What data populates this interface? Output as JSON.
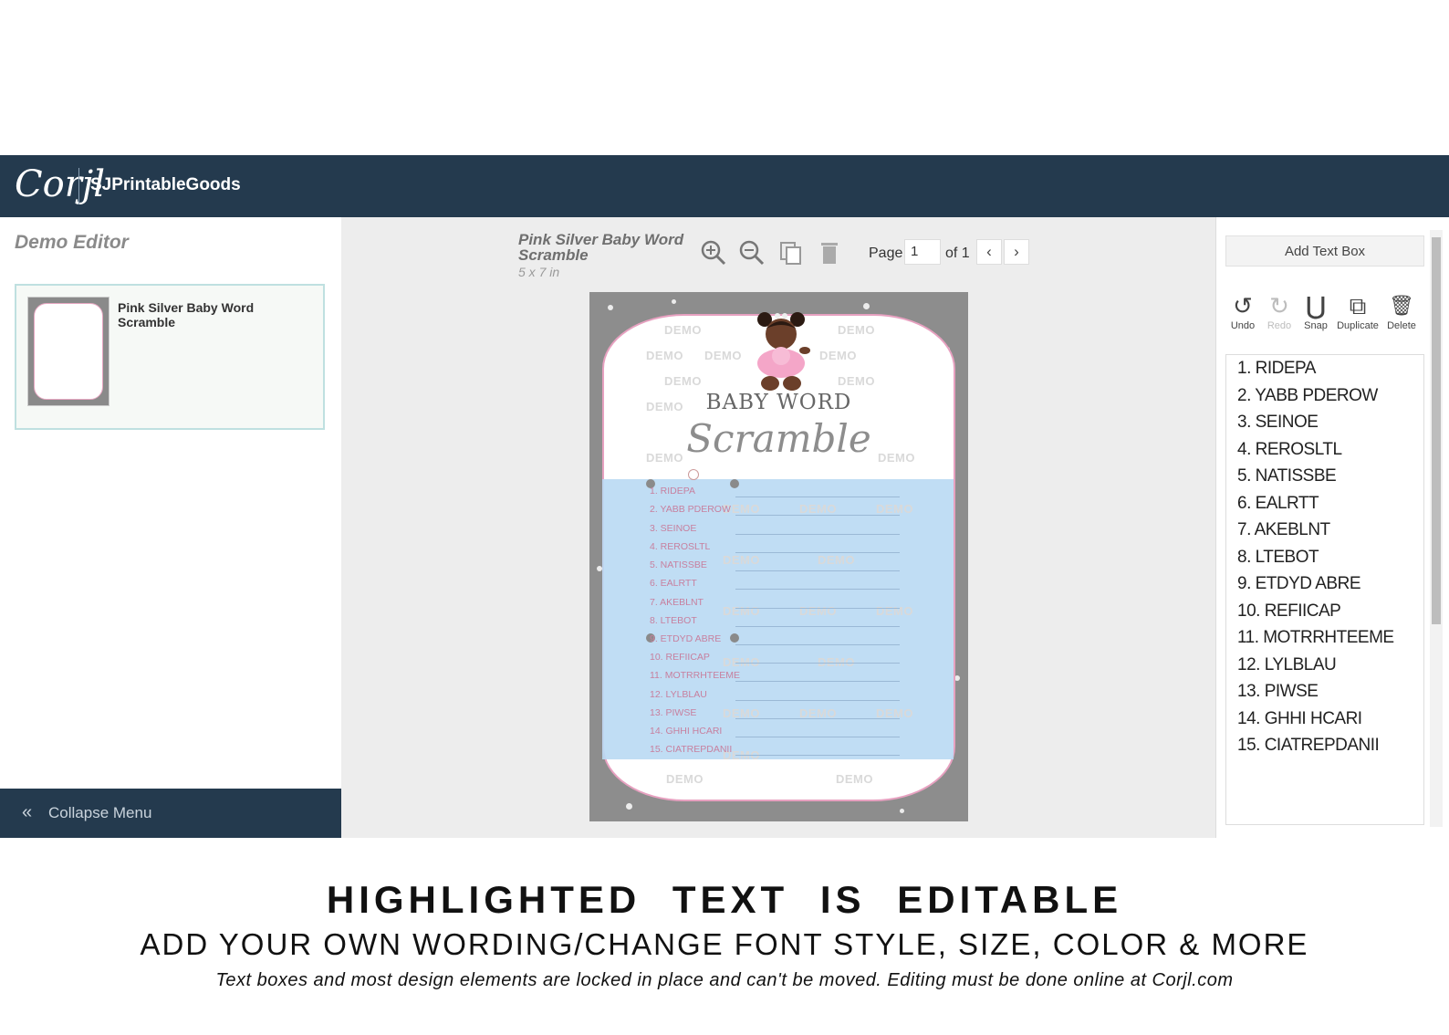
{
  "header": {
    "logo": "Corjl",
    "shop_name": "SJPrintableGoods"
  },
  "left_panel": {
    "title": "Demo Editor",
    "template_name": "Pink Silver Baby Word Scramble",
    "collapse_icon": "double-chevron-left-icon",
    "collapse_label": "Collapse Menu"
  },
  "canvas": {
    "doc_title": "Pink Silver Baby Word Scramble",
    "doc_size": "5 x 7 in",
    "page_label": "Page",
    "page_value": "1",
    "of_label": "of 1",
    "prev_icon": "chevron-left-icon",
    "next_icon": "chevron-right-icon",
    "toolbar_icons": [
      "zoom-in-icon",
      "zoom-out-icon",
      "copy-page-icon",
      "trash-icon"
    ]
  },
  "card": {
    "heading1": "BABY WORD",
    "heading2": "Scramble",
    "watermark": "DEMO",
    "words": [
      "1. RIDEPA",
      "2. YABB PDEROW",
      "3. SEINOE",
      "4. REROSLTL",
      "5. NATISSBE",
      "6. EALRTT",
      "7. AKEBLNT",
      "8. LTEBOT",
      "9. ETDYD ABRE",
      "10. REFIICAP",
      "11. MOTRRHTEEME",
      "12. LYLBLAU",
      "13. PIWSE",
      "14. GHHI HCARI",
      "15. CIATREPDANII"
    ]
  },
  "right_panel": {
    "add_text_label": "Add Text Box",
    "tools": [
      {
        "icon": "undo-icon",
        "glyph": "↺",
        "label": "Undo",
        "enabled": true
      },
      {
        "icon": "redo-icon",
        "glyph": "↻",
        "label": "Redo",
        "enabled": false
      },
      {
        "icon": "magnet-icon",
        "glyph": "⋃",
        "label": "Snap",
        "enabled": true
      },
      {
        "icon": "duplicate-icon",
        "glyph": "⧉",
        "label": "Duplicate",
        "enabled": true
      },
      {
        "icon": "trash-icon",
        "glyph": "🗑",
        "label": "Delete",
        "enabled": true
      }
    ],
    "words": [
      "1. RIDEPA",
      "2. YABB PDEROW",
      "3. SEINOE",
      "4. REROSLTL",
      "5. NATISSBE",
      "6. EALRTT",
      "7. AKEBLNT",
      "8. LTEBOT",
      "9. ETDYD ABRE",
      "10. REFIICAP",
      "11. MOTRRHTEEME",
      "12. LYLBLAU",
      "13. PIWSE",
      "14. GHHI HCARI",
      "15. CIATREPDANII"
    ]
  },
  "captions": {
    "line1": "HIGHLIGHTED TEXT IS EDITABLE",
    "line2": "ADD YOUR OWN WORDING/CHANGE FONT STYLE, SIZE, COLOR & MORE",
    "line3": "Text boxes and most design elements are locked in place and can't be moved. Editing must be done online at Corjl.com"
  },
  "colors": {
    "topbar": "#243a4e",
    "canvas_bg": "#ededed",
    "highlight": "#b9d9f3",
    "card_border": "#e7a1c0"
  }
}
